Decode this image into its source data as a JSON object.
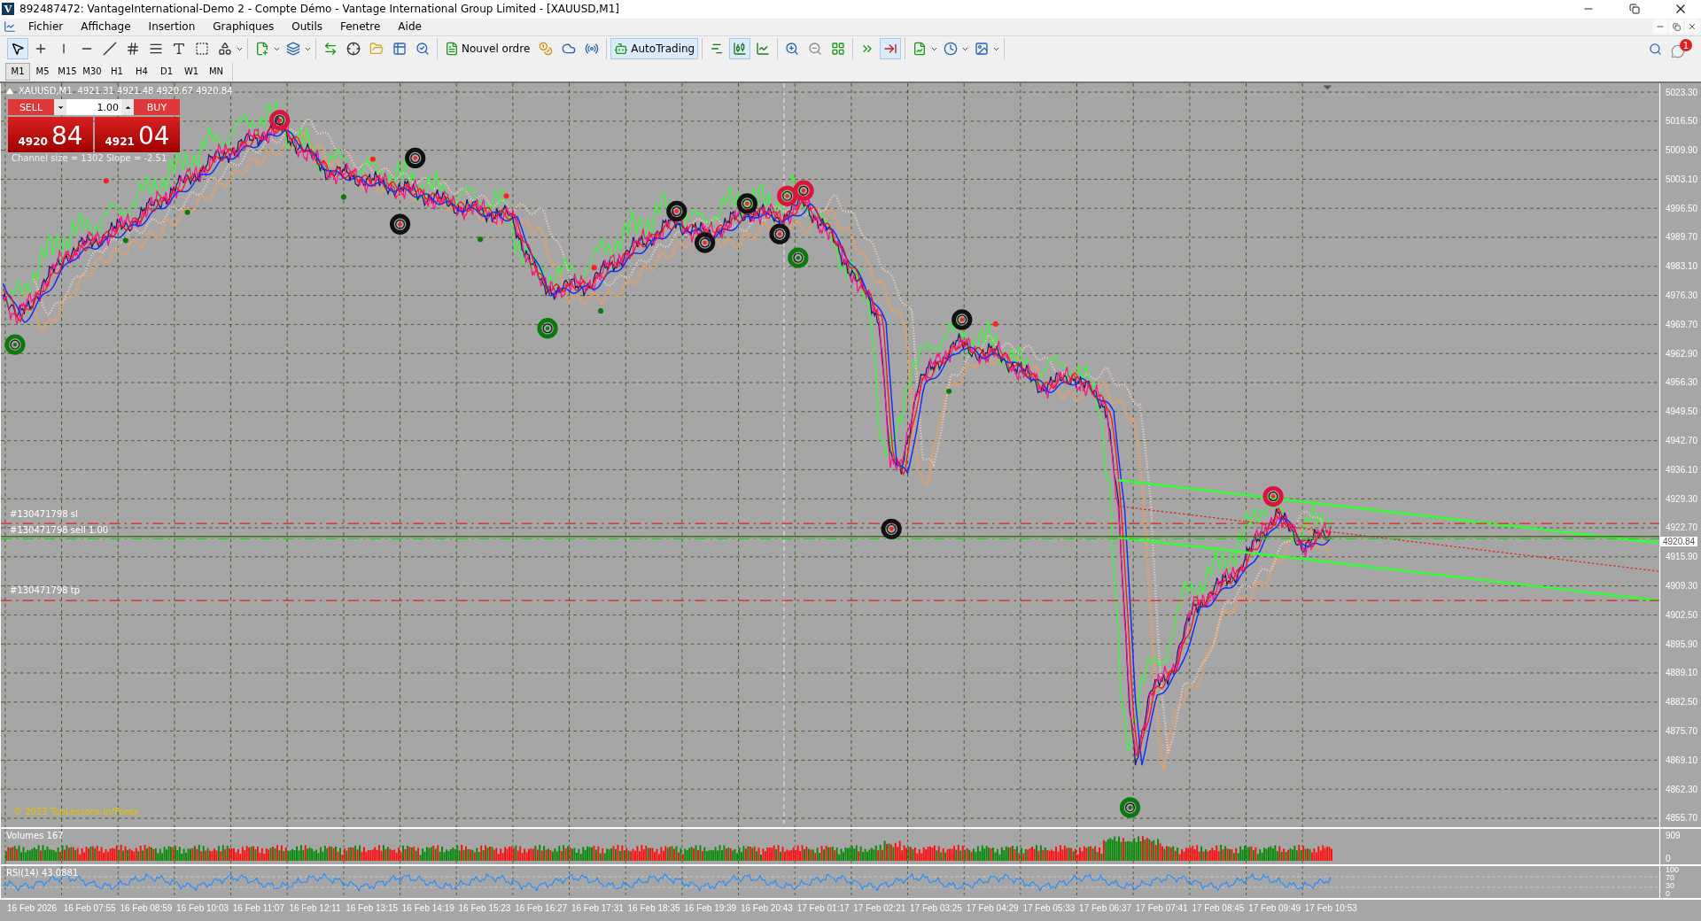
{
  "window": {
    "logo": "V",
    "title": "892487472: VantageInternational-Demo 2 - Compte Démo - Vantage International Group Limited - [XAUUSD,M1]"
  },
  "menu": [
    "Fichier",
    "Affichage",
    "Insertion",
    "Graphiques",
    "Outils",
    "Fenetre",
    "Aide"
  ],
  "toolbar": {
    "groups": [
      [
        {
          "selected": true,
          "dropdown": false
        },
        {
          "selected": false,
          "dropdown": false
        },
        {
          "selected": false,
          "dropdown": false
        },
        {
          "selected": false,
          "dropdown": false
        },
        {
          "selected": false,
          "dropdown": false
        },
        {
          "selected": false,
          "dropdown": false
        },
        {
          "selected": false,
          "dropdown": false
        },
        {
          "selected": false,
          "dropdown": false
        },
        {
          "selected": false,
          "dropdown": false
        },
        {
          "selected": false,
          "dropdown": true
        }
      ],
      [
        {
          "selected": false,
          "dropdown": true
        },
        {
          "selected": false,
          "dropdown": true
        }
      ],
      [
        {
          "selected": false,
          "dropdown": false
        },
        {
          "selected": false,
          "dropdown": false
        },
        {
          "selected": false,
          "dropdown": false
        },
        {
          "selected": false,
          "dropdown": false
        },
        {
          "selected": false,
          "dropdown": false
        }
      ],
      [
        {
          "selected": false,
          "dropdown": false,
          "label": "Nouvel ordre"
        },
        {
          "selected": false,
          "dropdown": false
        },
        {
          "selected": false,
          "dropdown": false
        },
        {
          "selected": false,
          "dropdown": false
        }
      ],
      [
        {
          "selected": true,
          "dropdown": false,
          "label": "AutoTrading"
        }
      ],
      [
        {
          "selected": false,
          "dropdown": false
        },
        {
          "selected": true,
          "dropdown": false
        },
        {
          "selected": false,
          "dropdown": false
        }
      ],
      [
        {
          "selected": false,
          "dropdown": false
        },
        {
          "selected": false,
          "dropdown": false
        },
        {
          "selected": false,
          "dropdown": false
        }
      ],
      [
        {
          "selected": false,
          "dropdown": false
        },
        {
          "selected": true,
          "dropdown": false
        }
      ],
      [
        {
          "selected": false,
          "dropdown": true
        },
        {
          "selected": false,
          "dropdown": true
        },
        {
          "selected": false,
          "dropdown": true
        }
      ]
    ]
  },
  "notifications": {
    "count": "1"
  },
  "timeframes": [
    {
      "label": "M1",
      "selected": true
    },
    {
      "label": "M5",
      "selected": false
    },
    {
      "label": "M15",
      "selected": false
    },
    {
      "label": "M30",
      "selected": false
    },
    {
      "label": "H1",
      "selected": false
    },
    {
      "label": "H4",
      "selected": false
    },
    {
      "label": "D1",
      "selected": false
    },
    {
      "label": "W1",
      "selected": false
    },
    {
      "label": "MN",
      "selected": false
    }
  ],
  "chart": {
    "header": {
      "symbol": "XAUUSD,M1",
      "ohlc": "4921.31 4921.48 4920.67 4920.84"
    },
    "trade_panel": {
      "sell_label": "SELL",
      "buy_label": "BUY",
      "lots": "1.00",
      "bid_main": "4920",
      "bid_pips": "84",
      "ask_main": "4921",
      "ask_pips": "04"
    },
    "channel_info": "Channel size = 1302 Slope = -2.51",
    "order_lines": [
      {
        "label": "#130471798 sl",
        "kind": "stop"
      },
      {
        "label": "#130471798 sell 1.00",
        "kind": "entry"
      },
      {
        "label": "#130471798 tp",
        "kind": "target"
      }
    ],
    "copyright": "© 2023 TopLessons.In/Forex",
    "price_ticks": [
      "5023.30",
      "5016.50",
      "5009.90",
      "5003.10",
      "4996.50",
      "4989.70",
      "4983.10",
      "4976.30",
      "4969.70",
      "4962.90",
      "4956.30",
      "4949.50",
      "4942.70",
      "4936.10",
      "4929.30",
      "4922.70",
      "4915.90",
      "4909.30",
      "4902.50",
      "4895.90",
      "4889.10",
      "4882.50",
      "4875.70",
      "4869.10",
      "4862.30",
      "4855.70"
    ],
    "current_price": "4920.84",
    "volumes": {
      "label": "Volumes 167",
      "ticks": [
        "909",
        "0"
      ]
    },
    "rsi": {
      "label": "RSI(14) 43.0881",
      "ticks": [
        "100",
        "70",
        "30",
        "0"
      ]
    },
    "time_labels": [
      "16 Feb 2026",
      "16 Feb 07:55",
      "16 Feb 08:59",
      "16 Feb 10:03",
      "16 Feb 11:07",
      "16 Feb 12:11",
      "16 Feb 13:15",
      "16 Feb 14:19",
      "16 Feb 15:23",
      "16 Feb 16:27",
      "16 Feb 17:31",
      "16 Feb 18:35",
      "16 Feb 19:39",
      "16 Feb 20:43",
      "17 Feb 01:17",
      "17 Feb 02:21",
      "17 Feb 03:25",
      "17 Feb 04:29",
      "17 Feb 05:33",
      "17 Feb 06:37",
      "17 Feb 07:41",
      "17 Feb 08:45",
      "17 Feb 09:49",
      "17 Feb 10:53"
    ]
  }
}
